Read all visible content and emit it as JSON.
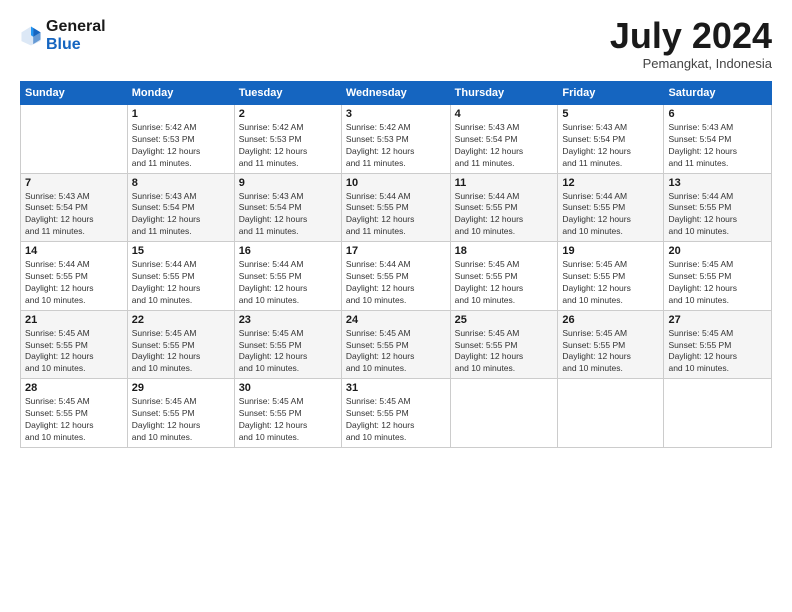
{
  "header": {
    "logo_general": "General",
    "logo_blue": "Blue",
    "title": "July 2024",
    "location": "Pemangkat, Indonesia"
  },
  "calendar": {
    "days_of_week": [
      "Sunday",
      "Monday",
      "Tuesday",
      "Wednesday",
      "Thursday",
      "Friday",
      "Saturday"
    ],
    "weeks": [
      [
        {
          "day": "",
          "info": ""
        },
        {
          "day": "1",
          "info": "Sunrise: 5:42 AM\nSunset: 5:53 PM\nDaylight: 12 hours\nand 11 minutes."
        },
        {
          "day": "2",
          "info": "Sunrise: 5:42 AM\nSunset: 5:53 PM\nDaylight: 12 hours\nand 11 minutes."
        },
        {
          "day": "3",
          "info": "Sunrise: 5:42 AM\nSunset: 5:53 PM\nDaylight: 12 hours\nand 11 minutes."
        },
        {
          "day": "4",
          "info": "Sunrise: 5:43 AM\nSunset: 5:54 PM\nDaylight: 12 hours\nand 11 minutes."
        },
        {
          "day": "5",
          "info": "Sunrise: 5:43 AM\nSunset: 5:54 PM\nDaylight: 12 hours\nand 11 minutes."
        },
        {
          "day": "6",
          "info": "Sunrise: 5:43 AM\nSunset: 5:54 PM\nDaylight: 12 hours\nand 11 minutes."
        }
      ],
      [
        {
          "day": "7",
          "info": "Sunrise: 5:43 AM\nSunset: 5:54 PM\nDaylight: 12 hours\nand 11 minutes."
        },
        {
          "day": "8",
          "info": "Sunrise: 5:43 AM\nSunset: 5:54 PM\nDaylight: 12 hours\nand 11 minutes."
        },
        {
          "day": "9",
          "info": "Sunrise: 5:43 AM\nSunset: 5:54 PM\nDaylight: 12 hours\nand 11 minutes."
        },
        {
          "day": "10",
          "info": "Sunrise: 5:44 AM\nSunset: 5:55 PM\nDaylight: 12 hours\nand 11 minutes."
        },
        {
          "day": "11",
          "info": "Sunrise: 5:44 AM\nSunset: 5:55 PM\nDaylight: 12 hours\nand 10 minutes."
        },
        {
          "day": "12",
          "info": "Sunrise: 5:44 AM\nSunset: 5:55 PM\nDaylight: 12 hours\nand 10 minutes."
        },
        {
          "day": "13",
          "info": "Sunrise: 5:44 AM\nSunset: 5:55 PM\nDaylight: 12 hours\nand 10 minutes."
        }
      ],
      [
        {
          "day": "14",
          "info": "Sunrise: 5:44 AM\nSunset: 5:55 PM\nDaylight: 12 hours\nand 10 minutes."
        },
        {
          "day": "15",
          "info": "Sunrise: 5:44 AM\nSunset: 5:55 PM\nDaylight: 12 hours\nand 10 minutes."
        },
        {
          "day": "16",
          "info": "Sunrise: 5:44 AM\nSunset: 5:55 PM\nDaylight: 12 hours\nand 10 minutes."
        },
        {
          "day": "17",
          "info": "Sunrise: 5:44 AM\nSunset: 5:55 PM\nDaylight: 12 hours\nand 10 minutes."
        },
        {
          "day": "18",
          "info": "Sunrise: 5:45 AM\nSunset: 5:55 PM\nDaylight: 12 hours\nand 10 minutes."
        },
        {
          "day": "19",
          "info": "Sunrise: 5:45 AM\nSunset: 5:55 PM\nDaylight: 12 hours\nand 10 minutes."
        },
        {
          "day": "20",
          "info": "Sunrise: 5:45 AM\nSunset: 5:55 PM\nDaylight: 12 hours\nand 10 minutes."
        }
      ],
      [
        {
          "day": "21",
          "info": "Sunrise: 5:45 AM\nSunset: 5:55 PM\nDaylight: 12 hours\nand 10 minutes."
        },
        {
          "day": "22",
          "info": "Sunrise: 5:45 AM\nSunset: 5:55 PM\nDaylight: 12 hours\nand 10 minutes."
        },
        {
          "day": "23",
          "info": "Sunrise: 5:45 AM\nSunset: 5:55 PM\nDaylight: 12 hours\nand 10 minutes."
        },
        {
          "day": "24",
          "info": "Sunrise: 5:45 AM\nSunset: 5:55 PM\nDaylight: 12 hours\nand 10 minutes."
        },
        {
          "day": "25",
          "info": "Sunrise: 5:45 AM\nSunset: 5:55 PM\nDaylight: 12 hours\nand 10 minutes."
        },
        {
          "day": "26",
          "info": "Sunrise: 5:45 AM\nSunset: 5:55 PM\nDaylight: 12 hours\nand 10 minutes."
        },
        {
          "day": "27",
          "info": "Sunrise: 5:45 AM\nSunset: 5:55 PM\nDaylight: 12 hours\nand 10 minutes."
        }
      ],
      [
        {
          "day": "28",
          "info": "Sunrise: 5:45 AM\nSunset: 5:55 PM\nDaylight: 12 hours\nand 10 minutes."
        },
        {
          "day": "29",
          "info": "Sunrise: 5:45 AM\nSunset: 5:55 PM\nDaylight: 12 hours\nand 10 minutes."
        },
        {
          "day": "30",
          "info": "Sunrise: 5:45 AM\nSunset: 5:55 PM\nDaylight: 12 hours\nand 10 minutes."
        },
        {
          "day": "31",
          "info": "Sunrise: 5:45 AM\nSunset: 5:55 PM\nDaylight: 12 hours\nand 10 minutes."
        },
        {
          "day": "",
          "info": ""
        },
        {
          "day": "",
          "info": ""
        },
        {
          "day": "",
          "info": ""
        }
      ]
    ]
  }
}
